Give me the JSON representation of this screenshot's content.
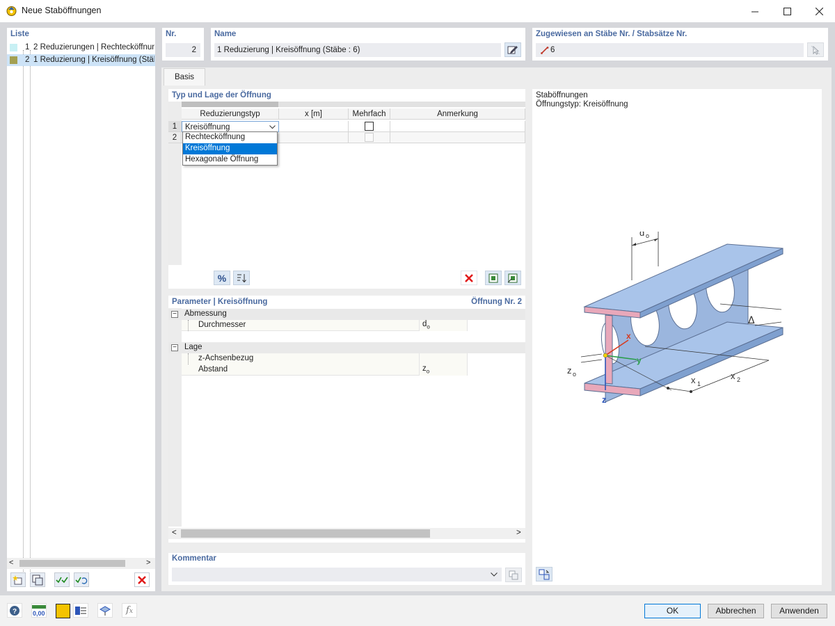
{
  "window": {
    "title": "Neue Staböffnungen"
  },
  "list": {
    "header": "Liste",
    "items": [
      {
        "num": "1",
        "label": "2 Reduzierungen | Rechtecköffnung",
        "color": "#c8f0f4"
      },
      {
        "num": "2",
        "label": "1 Reduzierung | Kreisöffnung (Stäbe : 6)",
        "color": "#a3a052"
      }
    ]
  },
  "nr": {
    "label": "Nr.",
    "value": "2"
  },
  "name": {
    "label": "Name",
    "value": "1 Reduzierung | Kreisöffnung (Stäbe : 6)"
  },
  "assigned": {
    "label": "Zugewiesen an Stäbe Nr. / Stabsätze Nr.",
    "value": "6"
  },
  "tabs": [
    {
      "label": "Basis"
    }
  ],
  "opening": {
    "header": "Typ und Lage der Öffnung",
    "columns": [
      "Reduzierungstyp",
      "x [m]",
      "Mehrfach",
      "Anmerkung"
    ],
    "rows": [
      {
        "num": "1",
        "type": "Kreisöffnung"
      },
      {
        "num": "2",
        "type": ""
      }
    ],
    "dropdown_options": [
      "Rechtecköffnung",
      "Kreisöffnung",
      "Hexagonale Öffnung"
    ]
  },
  "params": {
    "header": "Parameter | Kreisöffnung",
    "right_label": "Öffnung Nr. 2",
    "groups": [
      {
        "name": "Abmessung",
        "items": [
          {
            "label": "Durchmesser",
            "symbol": "d",
            "sub": "o"
          }
        ]
      },
      {
        "name": "Lage",
        "items": [
          {
            "label": "z-Achsenbezug",
            "symbol": "",
            "sub": ""
          },
          {
            "label": "Abstand",
            "symbol": "z",
            "sub": "o"
          }
        ]
      }
    ]
  },
  "preview": {
    "line1": "Staböffnungen",
    "line2": "Öffnungstyp: Kreisöffnung",
    "labels": {
      "d": "d",
      "d_sub": "o",
      "delta": "Δ",
      "x": "x",
      "y": "y",
      "z": "z",
      "zo": "z",
      "zo_sub": "o",
      "x1": "x",
      "x1_sub": "1",
      "x2": "x",
      "x2_sub": "2"
    }
  },
  "comment": {
    "label": "Kommentar",
    "value": ""
  },
  "buttons": {
    "ok": "OK",
    "cancel": "Abbrechen",
    "apply": "Anwenden"
  },
  "footer_icons": {
    "units_label": "0,00"
  }
}
